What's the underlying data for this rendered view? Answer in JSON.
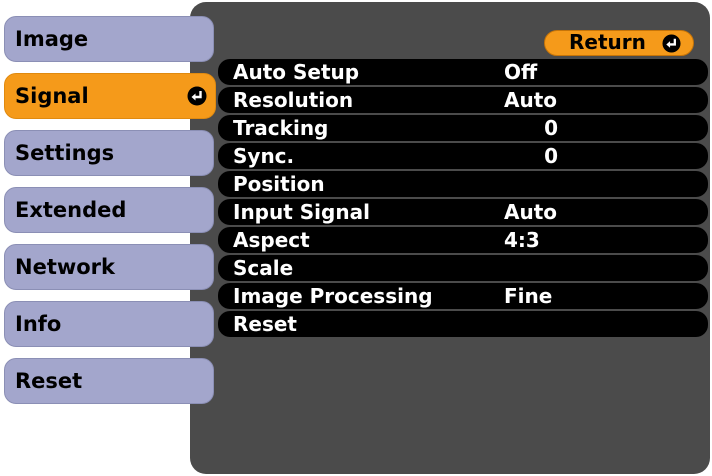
{
  "tabs": [
    {
      "label": "Image"
    },
    {
      "label": "Signal"
    },
    {
      "label": "Settings"
    },
    {
      "label": "Extended"
    },
    {
      "label": "Network"
    },
    {
      "label": "Info"
    },
    {
      "label": "Reset"
    }
  ],
  "active_tab": "Signal",
  "return_button": {
    "label": "Return"
  },
  "rows": [
    {
      "label": "Auto Setup",
      "value": "Off"
    },
    {
      "label": "Resolution",
      "value": "Auto"
    },
    {
      "label": "Tracking",
      "value": "0"
    },
    {
      "label": "Sync.",
      "value": "0"
    },
    {
      "label": "Position",
      "value": ""
    },
    {
      "label": "Input Signal",
      "value": "Auto"
    },
    {
      "label": "Aspect",
      "value": "4:3"
    },
    {
      "label": "Scale",
      "value": ""
    },
    {
      "label": "Image Processing",
      "value": "Fine"
    },
    {
      "label": "Reset",
      "value": ""
    }
  ],
  "colors": {
    "tab_bg": "#a3a6cc",
    "tab_active_bg": "#f59a1a",
    "panel_bg": "#4b4b4b",
    "row_bg": "#000000",
    "row_text": "#ffffff"
  },
  "icons": {
    "enter": "enter-return-icon"
  }
}
